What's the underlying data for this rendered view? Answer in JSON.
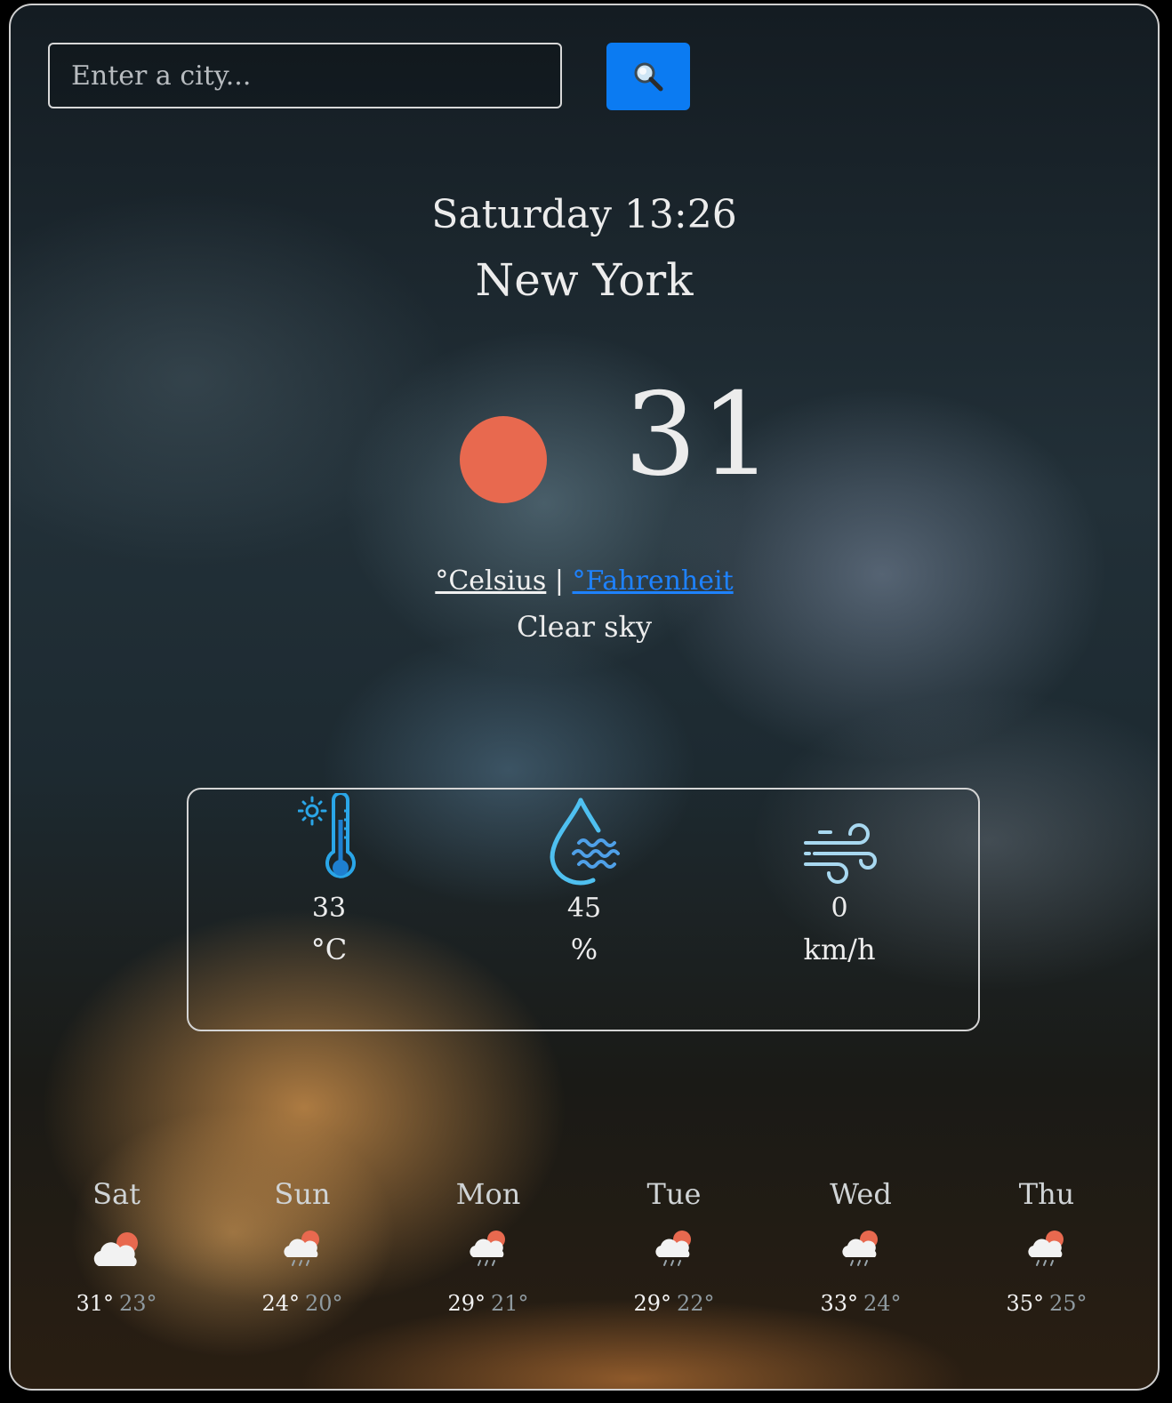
{
  "search": {
    "placeholder": "Enter a city...",
    "button_icon": "magnifier-icon"
  },
  "current": {
    "datetime": "Saturday 13:26",
    "city": "New York",
    "temperature": "31",
    "icon": "sun-icon",
    "unit_celsius": "°Celsius",
    "unit_separator": "|",
    "unit_fahrenheit": "°Fahrenheit",
    "description": "Clear sky"
  },
  "details": [
    {
      "name": "feels-like",
      "icon": "thermometer-sun-icon",
      "value": "33",
      "unit": "°C"
    },
    {
      "name": "humidity",
      "icon": "humidity-drop-icon",
      "value": "45",
      "unit": "%"
    },
    {
      "name": "wind",
      "icon": "wind-icon",
      "value": "0",
      "unit": "km/h"
    }
  ],
  "forecast": [
    {
      "day": "Sat",
      "icon": "cloud-sun-icon",
      "max": "31°",
      "min": "23°"
    },
    {
      "day": "Sun",
      "icon": "cloud-sun-rain-icon",
      "max": "24°",
      "min": "20°"
    },
    {
      "day": "Mon",
      "icon": "cloud-sun-rain-icon",
      "max": "29°",
      "min": "21°"
    },
    {
      "day": "Tue",
      "icon": "cloud-sun-rain-icon",
      "max": "29°",
      "min": "22°"
    },
    {
      "day": "Wed",
      "icon": "cloud-sun-rain-icon",
      "max": "33°",
      "min": "24°"
    },
    {
      "day": "Thu",
      "icon": "cloud-sun-rain-icon",
      "max": "35°",
      "min": "25°"
    }
  ],
  "colors": {
    "accent": "#0b7bf2",
    "sun": "#e8694f",
    "fahrenheit_link": "#1e82ff",
    "icon_blue": "#2aa6e8"
  }
}
